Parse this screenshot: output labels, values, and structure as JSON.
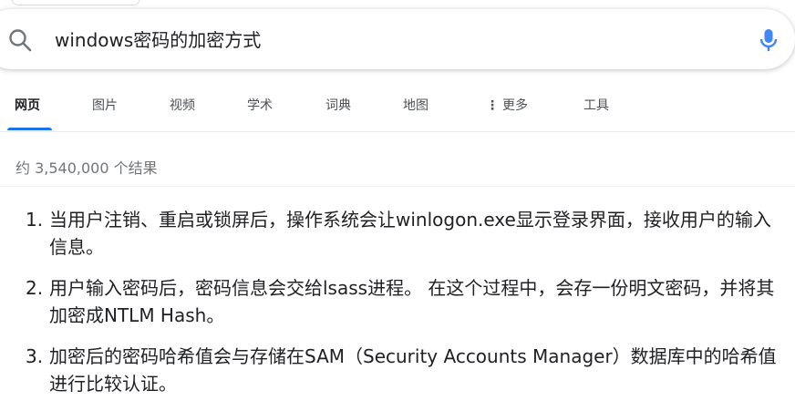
{
  "search": {
    "query": "windows密码的加密方式"
  },
  "tabs": [
    {
      "label": "网页"
    },
    {
      "label": "图片"
    },
    {
      "label": "视频"
    },
    {
      "label": "学术"
    },
    {
      "label": "词典"
    },
    {
      "label": "地图"
    },
    {
      "label": "更多"
    },
    {
      "label": "工具"
    }
  ],
  "stats": {
    "text": "约 3,540,000 个结果"
  },
  "answers": [
    {
      "num": "1.",
      "text": "当用户注销、重启或锁屏后，操作系统会让winlogon.exe显示登录界面，接收用户的输入信息。"
    },
    {
      "num": "2.",
      "text": "用户输入密码后，密码信息会交给lsass进程。 在这个过程中，会存一份明文密码，并将其加密成NTLM Hash。"
    },
    {
      "num": "3.",
      "text": "加密后的密码哈希值会与存储在SAM（Security Accounts Manager）数据库中的哈希值进行比较认证。"
    }
  ],
  "colors": {
    "accent": "#1a73e8",
    "mic_blue": "#4285f4",
    "text": "#202124",
    "muted": "#70757a"
  }
}
